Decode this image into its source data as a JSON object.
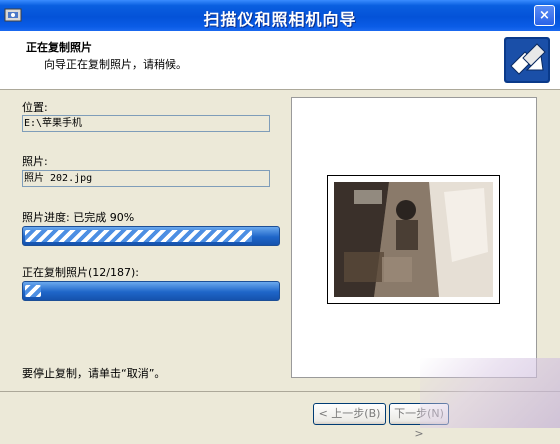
{
  "window": {
    "title": "扫描仪和照相机向导",
    "close_glyph": "×"
  },
  "header": {
    "title": "正在复制照片",
    "subtitle": "向导正在复制照片，请稍候。"
  },
  "location": {
    "label": "位置:",
    "value": "E:\\苹果手机"
  },
  "photo": {
    "label": "照片:",
    "value": "照片 202.jpg"
  },
  "photo_progress": {
    "label": "照片进度: 已完成 90%",
    "fraction": 0.9
  },
  "copy_progress": {
    "label": "正在复制照片(12/187):",
    "fraction": 0.064
  },
  "footer": {
    "instruction": "要停止复制，请单击“取消”。"
  },
  "buttons": {
    "back": "< 上一步(B)",
    "next": "下一步(N) >"
  },
  "colors": {
    "titlebar": "#0452d8",
    "progress": "#1f66c9",
    "dialog_bg": "#ece9d8"
  }
}
